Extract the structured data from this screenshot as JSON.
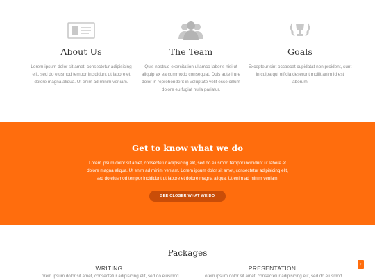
{
  "features": [
    {
      "icon": "id-card-icon",
      "title": "About Us",
      "text": "Lorem ipsum dolor sit amet, consectetur adipisicing elit, sed do eiusmod tempor incididunt ut labore et dolore magna aliqua. Ut enim ad minim veniam."
    },
    {
      "icon": "team-icon",
      "title": "The Team",
      "text": "Quis nostrud exercitation ullamco laboris nisi ut aliquip ex ea commodo consequat. Duis aute irure dolor in reprehenderit in voluptate velit esse cillum dolore eu fugiat nulla pariatur."
    },
    {
      "icon": "trophy-icon",
      "title": "Goals",
      "text": "Excepteur sint occaecat cupidatat non proident, sunt in culpa qui officia deserunt mollit anim id est laborum."
    }
  ],
  "band": {
    "title": "Get to know what we do",
    "text": "Lorem ipsum dolor sit amet, consectetur adipisicing elit, sed do eiusmod tempor incididunt ut labore et dolore magna aliqua. Ut enim ad minim veniam. Lorem ipsum dolor sit amet, consectetur adipisicing elit, sed do eiusmod tempor incididunt ut labore et dolore magna aliqua. Ut enim ad minim veniam.",
    "cta_label": "See closer what we do"
  },
  "packages": {
    "title": "Packages",
    "items": [
      {
        "name": "WRITING",
        "text": "Lorem ipsum dolor sit amet, consectetur adipisicing elit, sed do eiusmod"
      },
      {
        "name": "PRESENTATION",
        "text": "Lorem ipsum dolor sit amet, consectetur adipisicing elit, sed do eiusmod"
      }
    ]
  },
  "to_top": {
    "label": "↑"
  },
  "colors": {
    "accent": "#ff6d0d",
    "button": "#c94d08",
    "icon": "#c8c8c8"
  }
}
